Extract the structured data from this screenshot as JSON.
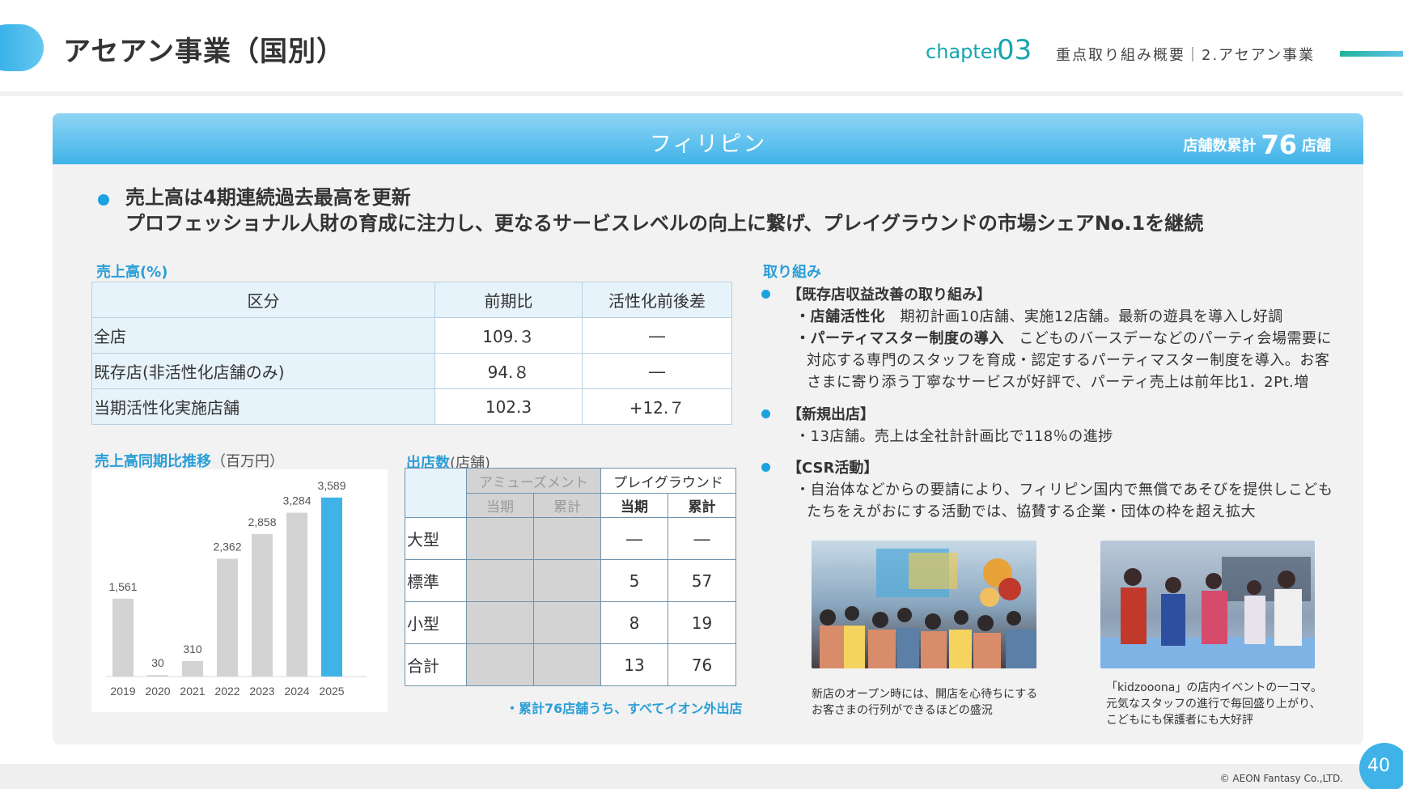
{
  "header": {
    "title": "アセアン事業（国別）",
    "chapter_label": "chapter",
    "chapter_num": "03",
    "breadcrumb": "重点取り組み概要｜2.アセアン事業"
  },
  "panel": {
    "country": "フィリピン",
    "store_count_prefix": "店舗数累計",
    "store_count_value": "76",
    "store_count_suffix": "店舗"
  },
  "headline": {
    "line1": "売上高は4期連続過去最高を更新",
    "line2": "プロフェッショナル人財の育成に注力し、更なるサービスレベルの向上に繋げ、プレイグラウンドの市場シェアNo.1を継続"
  },
  "sales_table": {
    "label": "売上高(%)",
    "headers": [
      "区分",
      "前期比",
      "活性化前後差"
    ],
    "rows": [
      {
        "label": "全店",
        "yoy": "109.３",
        "diff": "―"
      },
      {
        "label": "既存店(非活性化店舗のみ)",
        "yoy": "94.８",
        "diff": "―"
      },
      {
        "label": "当期活性化実施店舗",
        "yoy": "102.3",
        "diff": "+12.７"
      }
    ]
  },
  "trend": {
    "label": "売上高同期比推移",
    "unit": "（百万円）"
  },
  "chart_data": {
    "type": "bar",
    "categories": [
      "2019",
      "2020",
      "2021",
      "2022",
      "2023",
      "2024",
      "2025"
    ],
    "values": [
      1561,
      30,
      310,
      2362,
      2858,
      3284,
      3589
    ],
    "value_labels": [
      "1,561",
      "30",
      "310",
      "2,362",
      "2,858",
      "3,284",
      "3,589"
    ],
    "ylim": [
      0,
      3700
    ],
    "colors": {
      "normal": "#d3d3d3",
      "highlight": "#3fb3e8"
    },
    "highlight_index": 6
  },
  "stores": {
    "label": "出店数",
    "unit": "(店舗)",
    "group_amusement": "アミューズメント",
    "group_playground": "プレイグラウンド",
    "sub_current": "当期",
    "sub_total": "累計",
    "rows": [
      {
        "label": "大型",
        "pg_current": "―",
        "pg_total": "―"
      },
      {
        "label": "標準",
        "pg_current": "5",
        "pg_total": "57"
      },
      {
        "label": "小型",
        "pg_current": "8",
        "pg_total": "19"
      },
      {
        "label": "合計",
        "pg_current": "13",
        "pg_total": "76"
      }
    ],
    "note": "・累計76店舗うち、すべてイオン外出店"
  },
  "initiatives": {
    "label": "取り組み",
    "b1_title": "【既存店収益改善の取り組み】",
    "b1_l1_bold": "・店舗活性化",
    "b1_l1": "　期初計画10店舗、実施12店舗。最新の遊具を導入し好調",
    "b1_l2_bold": "・パーティマスター制度の導入",
    "b1_l2": "　こどものバースデーなどのパーティ会場需要に",
    "b1_l3": "対応する専門のスタッフを育成・認定するパーティマスター制度を導入。お客",
    "b1_l4": "さまに寄り添う丁寧なサービスが好評で、パーティ売上は前年比1．2Pt.増",
    "b2_title": "【新規出店】",
    "b2_l1": "・13店舗。売上は全社計計画比で118％の進捗",
    "b3_title": "【CSR活動】",
    "b3_l1": "・自治体などからの要請により、フィリピン国内で無償であそびを提供しこども",
    "b3_l2": "たちをえがおにする活動では、協賛する企業・団体の枠を超え拡大"
  },
  "photos": {
    "caption1_l1": "新店のオープン時には、開店を心待ちにする",
    "caption1_l2": "お客さまの行列ができるほどの盛況",
    "caption2_l1": "「kidzooona」の店内イベントの一コマ。",
    "caption2_l2": "元気なスタッフの進行で毎回盛り上がり、",
    "caption2_l3": "こどもにも保護者にも大好評"
  },
  "footer": {
    "copyright": "© AEON Fantasy Co.,LTD.",
    "page": "40"
  }
}
